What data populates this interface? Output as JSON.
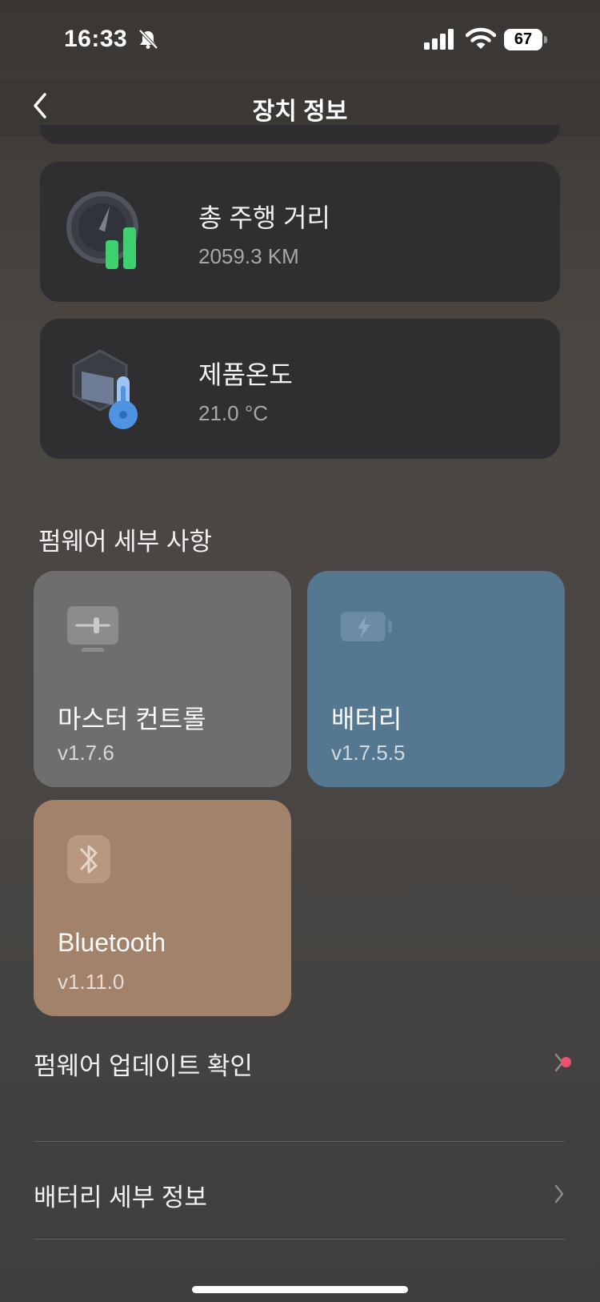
{
  "status_bar": {
    "time": "16:33",
    "battery_level": "67"
  },
  "nav": {
    "title": "장치 정보"
  },
  "info_cards": [
    {
      "title": "총 주행 거리",
      "value": "2059.3 KM",
      "icon": "odometer-gauge-icon"
    },
    {
      "title": "제품온도",
      "value": "21.0 °C",
      "icon": "thermometer-icon"
    }
  ],
  "firmware": {
    "section_title": "펌웨어 세부 사항",
    "items": [
      {
        "name": "마스터 컨트롤",
        "version": "v1.7.6",
        "icon": "controller-icon",
        "color": "#6e6e6e"
      },
      {
        "name": "배터리",
        "version": "v1.7.5.5",
        "icon": "battery-charging-icon",
        "color": "#55778f"
      },
      {
        "name": "Bluetooth",
        "version": "v1.11.0",
        "icon": "bluetooth-icon",
        "color": "#a2826a"
      }
    ]
  },
  "menu": [
    {
      "label": "펌웨어 업데이트 확인",
      "has_badge": true
    },
    {
      "label": "배터리 세부 정보",
      "has_badge": false
    }
  ],
  "colors": {
    "card_bg": "#2f2f31",
    "badge": "#e9536c",
    "accent_green": "#3ecf6e",
    "accent_blue": "#4f93e3"
  }
}
